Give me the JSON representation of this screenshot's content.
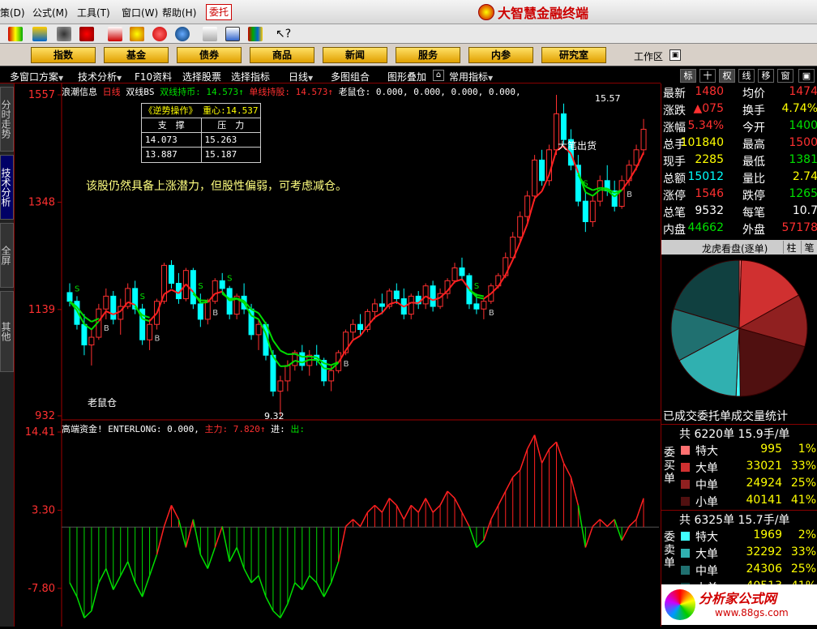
{
  "menu": {
    "items": [
      "策(D)",
      "公式(M)",
      "工具(T)",
      "窗口(W)",
      "帮助(H)"
    ],
    "weituo": "委托",
    "brand": "大智慧金融终端"
  },
  "nav": {
    "buttons": [
      "指数",
      "基金",
      "债券",
      "商品",
      "新闻",
      "服务",
      "内参",
      "研究室"
    ],
    "workarea": "工作区"
  },
  "subbar": {
    "items": [
      "多窗口方案",
      "技术分析",
      "F10资料",
      "选择股票",
      "选择指标",
      "日线",
      "多图组合",
      "图形叠加",
      "常用指标"
    ]
  },
  "righttabs": [
    "标",
    "十",
    "权",
    "线",
    "移",
    "窗",
    "▣"
  ],
  "lefttabs": [
    "分时走势",
    "技术分析",
    "全屏",
    "其他"
  ],
  "chart": {
    "header_prefix": "浪潮信息",
    "header_period": "日线",
    "header_indicator": "双线BS",
    "header_dual": "双线持币: 14.573↑",
    "header_single": "单线持股: 14.573↑",
    "header_rest": "老鼠仓: 0.000, 0.000, 0.000, 0.000,",
    "price_ticks": [
      "1557",
      "1348",
      "1139",
      "932"
    ],
    "high_label": "15.57",
    "low_label": "9.32",
    "note": "该股仍然具备上涨潜力，但股性偏弱，可考虑减仓。",
    "label_laoshu": "老鼠仓",
    "label_dabi": "大笔出货",
    "sr_box": {
      "title": "《逆势操作》 重心:14.537",
      "col1": "支　撑",
      "col2": "压　力",
      "rows": [
        [
          "14.073",
          "15.263"
        ],
        [
          "13.887",
          "15.187"
        ]
      ]
    },
    "ind_header": "高端资金! ENTERLONG: 0.000,",
    "ind_zhuli": "主力: 7.820↑",
    "ind_jin": "进:",
    "ind_chu": "出:",
    "ind_ticks": [
      "14.41",
      "3.30",
      "-7.80"
    ],
    "colors": {
      "up": "#ff3030",
      "down": "#00ffff",
      "ma_red": "#ff2020",
      "ma_green": "#00dd00",
      "ind_pos": "#ff2020",
      "ind_neg": "#00dd00",
      "axis": "#a00000"
    }
  },
  "chart_data": {
    "type": "table",
    "candles": [
      [
        11.72,
        11.9,
        11.45,
        11.55
      ],
      [
        11.55,
        11.65,
        11.0,
        11.1
      ],
      [
        11.1,
        11.3,
        10.5,
        10.7
      ],
      [
        10.7,
        11.0,
        10.3,
        10.85
      ],
      [
        10.85,
        11.5,
        10.8,
        11.4
      ],
      [
        11.4,
        11.8,
        11.2,
        11.65
      ],
      [
        11.65,
        11.75,
        11.1,
        11.2
      ],
      [
        11.2,
        11.6,
        10.9,
        11.45
      ],
      [
        11.45,
        11.9,
        11.4,
        11.8
      ],
      [
        11.8,
        11.95,
        11.3,
        11.4
      ],
      [
        11.4,
        11.5,
        10.7,
        10.8
      ],
      [
        10.8,
        11.2,
        10.6,
        11.1
      ],
      [
        11.1,
        11.6,
        11.0,
        11.55
      ],
      [
        11.55,
        12.3,
        11.5,
        12.25
      ],
      [
        12.25,
        12.35,
        11.8,
        11.9
      ],
      [
        11.9,
        12.1,
        11.5,
        11.6
      ],
      [
        11.6,
        12.2,
        11.55,
        12.15
      ],
      [
        12.15,
        12.2,
        11.4,
        11.5
      ],
      [
        11.5,
        11.7,
        11.05,
        11.2
      ],
      [
        11.2,
        11.6,
        11.1,
        11.55
      ],
      [
        11.55,
        12.0,
        11.5,
        11.95
      ],
      [
        11.95,
        12.1,
        11.7,
        11.8
      ],
      [
        11.8,
        11.85,
        11.2,
        11.3
      ],
      [
        11.3,
        11.7,
        11.2,
        11.65
      ],
      [
        11.65,
        11.9,
        11.3,
        11.4
      ],
      [
        11.4,
        11.5,
        10.8,
        10.9
      ],
      [
        10.9,
        11.2,
        10.6,
        11.1
      ],
      [
        11.1,
        11.15,
        10.4,
        10.5
      ],
      [
        10.5,
        10.6,
        9.7,
        9.8
      ],
      [
        9.8,
        10.1,
        9.32,
        10.0
      ],
      [
        10.0,
        10.4,
        9.8,
        10.3
      ],
      [
        10.3,
        10.6,
        10.2,
        10.55
      ],
      [
        10.55,
        10.7,
        10.2,
        10.3
      ],
      [
        10.3,
        10.6,
        10.1,
        10.5
      ],
      [
        10.5,
        10.7,
        10.3,
        10.4
      ],
      [
        10.4,
        10.45,
        9.9,
        10.0
      ],
      [
        10.0,
        10.3,
        9.8,
        10.2
      ],
      [
        10.2,
        10.6,
        10.15,
        10.55
      ],
      [
        10.55,
        11.0,
        10.5,
        10.95
      ],
      [
        10.95,
        11.2,
        10.8,
        11.1
      ],
      [
        11.1,
        11.3,
        10.9,
        11.0
      ],
      [
        11.0,
        11.4,
        10.95,
        11.35
      ],
      [
        11.35,
        11.6,
        11.2,
        11.5
      ],
      [
        11.5,
        11.7,
        11.3,
        11.45
      ],
      [
        11.45,
        11.8,
        11.4,
        11.75
      ],
      [
        11.75,
        11.9,
        11.5,
        11.6
      ],
      [
        11.6,
        11.8,
        11.2,
        11.3
      ],
      [
        11.3,
        11.7,
        11.2,
        11.65
      ],
      [
        11.65,
        11.75,
        11.4,
        11.5
      ],
      [
        11.5,
        11.9,
        11.4,
        11.85
      ],
      [
        11.85,
        11.95,
        11.35,
        11.45
      ],
      [
        11.45,
        11.8,
        11.4,
        11.7
      ],
      [
        11.7,
        12.0,
        11.6,
        11.95
      ],
      [
        11.95,
        12.3,
        11.9,
        12.2
      ],
      [
        12.2,
        12.4,
        11.95,
        12.05
      ],
      [
        12.05,
        12.1,
        11.4,
        11.5
      ],
      [
        11.5,
        11.7,
        11.3,
        11.4
      ],
      [
        11.4,
        11.6,
        11.2,
        11.55
      ],
      [
        11.55,
        11.9,
        11.5,
        11.85
      ],
      [
        11.85,
        12.1,
        11.8,
        12.05
      ],
      [
        12.05,
        12.5,
        12.0,
        12.4
      ],
      [
        12.4,
        12.9,
        12.35,
        12.8
      ],
      [
        12.8,
        13.3,
        12.7,
        13.2
      ],
      [
        13.2,
        13.7,
        13.1,
        13.6
      ],
      [
        13.6,
        14.4,
        13.5,
        14.3
      ],
      [
        14.3,
        14.5,
        13.8,
        13.9
      ],
      [
        13.9,
        14.6,
        13.8,
        14.5
      ],
      [
        14.5,
        15.57,
        14.4,
        15.2
      ],
      [
        15.2,
        15.4,
        14.6,
        14.7
      ],
      [
        14.7,
        14.9,
        14.1,
        14.2
      ],
      [
        14.2,
        14.4,
        13.4,
        13.5
      ],
      [
        13.5,
        13.7,
        12.9,
        13.1
      ],
      [
        13.1,
        13.6,
        13.0,
        13.5
      ],
      [
        13.5,
        14.0,
        13.4,
        13.9
      ],
      [
        13.9,
        14.2,
        13.6,
        13.7
      ],
      [
        13.7,
        13.9,
        13.3,
        13.4
      ],
      [
        13.4,
        14.0,
        13.35,
        13.9
      ],
      [
        13.9,
        14.3,
        13.8,
        14.2
      ],
      [
        14.2,
        14.6,
        14.1,
        14.5
      ],
      [
        14.5,
        15.1,
        14.4,
        14.9
      ]
    ],
    "indicator": [
      -6,
      -8,
      -11,
      -10,
      -6,
      -4,
      -7,
      -5,
      -3,
      -6,
      -8,
      -5,
      -2,
      1,
      4,
      2,
      -1,
      2,
      -2,
      -4,
      -1,
      1,
      -3,
      -1,
      -4,
      -6,
      -5,
      -8,
      -10,
      -11,
      -9,
      -6,
      -7,
      -5,
      -6,
      -8,
      -6,
      -3,
      1,
      2,
      1,
      3,
      4,
      3,
      5,
      4,
      2,
      4,
      3,
      5,
      3,
      4,
      6,
      5,
      3,
      1,
      -1,
      0,
      2,
      4,
      6,
      8,
      9,
      12,
      14,
      10,
      12,
      13,
      10,
      8,
      4,
      -1,
      1,
      2,
      1,
      2,
      0,
      1,
      2,
      5
    ],
    "order_stats": {
      "title": "已成交委托单成交量统计",
      "buy": {
        "label": "委买单",
        "summary": "共 6220单 15.9手/单",
        "rows": [
          {
            "name": "特大",
            "num": "995",
            "pct": "1%",
            "color": "#ff7070"
          },
          {
            "name": "大单",
            "num": "33021",
            "pct": "33%",
            "color": "#d03030"
          },
          {
            "name": "中单",
            "num": "24924",
            "pct": "25%",
            "color": "#902020"
          },
          {
            "name": "小单",
            "num": "40141",
            "pct": "41%",
            "color": "#501010"
          }
        ]
      },
      "sell": {
        "label": "委卖单",
        "summary": "共 6325单 15.7手/单",
        "rows": [
          {
            "name": "特大",
            "num": "1969",
            "pct": "2%",
            "color": "#40ffff"
          },
          {
            "name": "大单",
            "num": "32292",
            "pct": "33%",
            "color": "#30b0b0"
          },
          {
            "name": "中单",
            "num": "24306",
            "pct": "25%",
            "color": "#207070"
          },
          {
            "name": "小单",
            "num": "40513",
            "pct": "41%",
            "color": "#104040"
          }
        ]
      }
    },
    "pie_slices": [
      1,
      33,
      25,
      41,
      2,
      33,
      25,
      41
    ]
  },
  "quotes": [
    {
      "l": "最新",
      "v": "1480",
      "vc": "red",
      "l2": "均价",
      "v2": "1474",
      "v2c": "red"
    },
    {
      "l": "涨跌",
      "v": "▲075",
      "vc": "red",
      "l2": "换手",
      "v2": "4.74%",
      "v2c": "yellow"
    },
    {
      "l": "涨幅",
      "v": "5.34%",
      "vc": "red",
      "l2": "今开",
      "v2": "1400",
      "v2c": "green"
    },
    {
      "l": "总手",
      "v": "101840",
      "vc": "yellow",
      "l2": "最高",
      "v2": "1500",
      "v2c": "red"
    },
    {
      "l": "现手",
      "v": "2285",
      "vc": "yellow",
      "l2": "最低",
      "v2": "1381",
      "v2c": "green"
    },
    {
      "l": "总额",
      "v": "15012",
      "vc": "cyan",
      "l2": "量比",
      "v2": "2.74",
      "v2c": "yellow"
    },
    {
      "l": "涨停",
      "v": "1546",
      "vc": "red",
      "l2": "跌停",
      "v2": "1265",
      "v2c": "green"
    },
    {
      "l": "总笔",
      "v": "9532",
      "vc": "white",
      "l2": "每笔",
      "v2": "10.7",
      "v2c": "white"
    },
    {
      "l": "内盘",
      "v": "44662",
      "vc": "green",
      "l2": "外盘",
      "v2": "57178",
      "v2c": "red"
    }
  ],
  "dragon": {
    "title": "龙虎看盘(逐单)",
    "tab1": "柱",
    "tab2": "笔"
  },
  "watermark": {
    "name": "分析家公式网",
    "url": "www.88gs.com"
  }
}
